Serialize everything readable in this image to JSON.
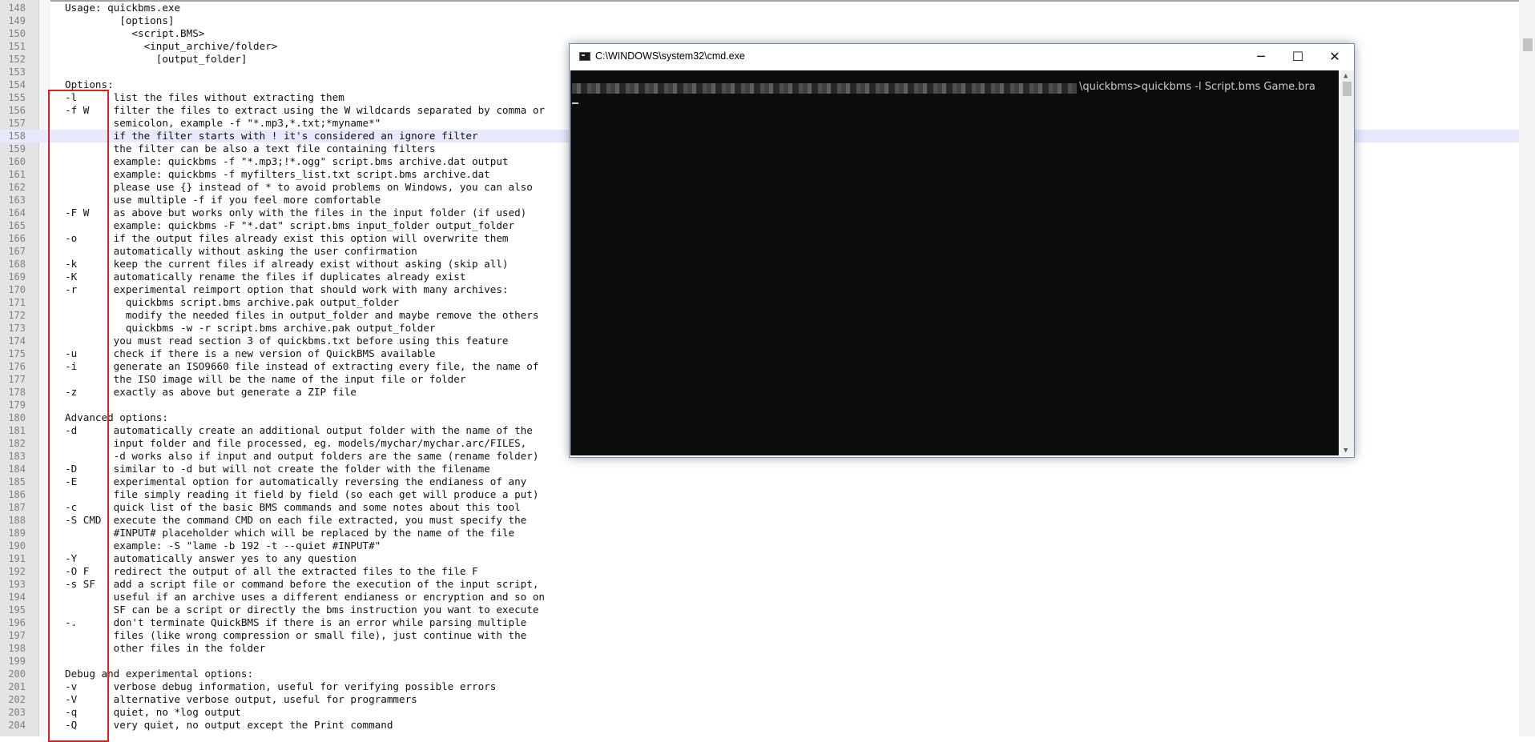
{
  "editor": {
    "current_line": 158,
    "lines": [
      {
        "num": "148",
        "text": "Usage: quickbms.exe"
      },
      {
        "num": "149",
        "text": "         [options]"
      },
      {
        "num": "150",
        "text": "           <script.BMS>"
      },
      {
        "num": "151",
        "text": "             <input_archive/folder>"
      },
      {
        "num": "152",
        "text": "               [output_folder]"
      },
      {
        "num": "153",
        "text": ""
      },
      {
        "num": "154",
        "text": "Options:"
      },
      {
        "num": "155",
        "text": "-l      list the files without extracting them"
      },
      {
        "num": "156",
        "text": "-f W    filter the files to extract using the W wildcards separated by comma or"
      },
      {
        "num": "157",
        "text": "        semicolon, example -f \"*.mp3,*.txt;*myname*\""
      },
      {
        "num": "158",
        "text": "        if the filter starts with ! it's considered an ignore filter"
      },
      {
        "num": "159",
        "text": "        the filter can be also a text file containing filters"
      },
      {
        "num": "160",
        "text": "        example: quickbms -f \"*.mp3;!*.ogg\" script.bms archive.dat output"
      },
      {
        "num": "161",
        "text": "        example: quickbms -f myfilters_list.txt script.bms archive.dat"
      },
      {
        "num": "162",
        "text": "        please use {} instead of * to avoid problems on Windows, you can also"
      },
      {
        "num": "163",
        "text": "        use multiple -f if you feel more comfortable"
      },
      {
        "num": "164",
        "text": "-F W    as above but works only with the files in the input folder (if used)"
      },
      {
        "num": "165",
        "text": "        example: quickbms -F \"*.dat\" script.bms input_folder output_folder"
      },
      {
        "num": "166",
        "text": "-o      if the output files already exist this option will overwrite them"
      },
      {
        "num": "167",
        "text": "        automatically without asking the user confirmation"
      },
      {
        "num": "168",
        "text": "-k      keep the current files if already exist without asking (skip all)"
      },
      {
        "num": "169",
        "text": "-K      automatically rename the files if duplicates already exist"
      },
      {
        "num": "170",
        "text": "-r      experimental reimport option that should work with many archives:"
      },
      {
        "num": "171",
        "text": "          quickbms script.bms archive.pak output_folder"
      },
      {
        "num": "172",
        "text": "          modify the needed files in output_folder and maybe remove the others"
      },
      {
        "num": "173",
        "text": "          quickbms -w -r script.bms archive.pak output_folder"
      },
      {
        "num": "174",
        "text": "        you must read section 3 of quickbms.txt before using this feature"
      },
      {
        "num": "175",
        "text": "-u      check if there is a new version of QuickBMS available"
      },
      {
        "num": "176",
        "text": "-i      generate an ISO9660 file instead of extracting every file, the name of"
      },
      {
        "num": "177",
        "text": "        the ISO image will be the name of the input file or folder"
      },
      {
        "num": "178",
        "text": "-z      exactly as above but generate a ZIP file"
      },
      {
        "num": "179",
        "text": ""
      },
      {
        "num": "180",
        "text": "Advanced options:"
      },
      {
        "num": "181",
        "text": "-d      automatically create an additional output folder with the name of the"
      },
      {
        "num": "182",
        "text": "        input folder and file processed, eg. models/mychar/mychar.arc/FILES,"
      },
      {
        "num": "183",
        "text": "        -d works also if input and output folders are the same (rename folder)"
      },
      {
        "num": "184",
        "text": "-D      similar to -d but will not create the folder with the filename"
      },
      {
        "num": "185",
        "text": "-E      experimental option for automatically reversing the endianess of any"
      },
      {
        "num": "186",
        "text": "        file simply reading it field by field (so each get will produce a put)"
      },
      {
        "num": "187",
        "text": "-c      quick list of the basic BMS commands and some notes about this tool"
      },
      {
        "num": "188",
        "text": "-S CMD  execute the command CMD on each file extracted, you must specify the"
      },
      {
        "num": "189",
        "text": "        #INPUT# placeholder which will be replaced by the name of the file"
      },
      {
        "num": "190",
        "text": "        example: -S \"lame -b 192 -t --quiet #INPUT#\""
      },
      {
        "num": "191",
        "text": "-Y      automatically answer yes to any question"
      },
      {
        "num": "192",
        "text": "-O F    redirect the output of all the extracted files to the file F"
      },
      {
        "num": "193",
        "text": "-s SF   add a script file or command before the execution of the input script,"
      },
      {
        "num": "194",
        "text": "        useful if an archive uses a different endianess or encryption and so on"
      },
      {
        "num": "195",
        "text": "        SF can be a script or directly the bms instruction you want to execute"
      },
      {
        "num": "196",
        "text": "-.      don't terminate QuickBMS if there is an error while parsing multiple"
      },
      {
        "num": "197",
        "text": "        files (like wrong compression or small file), just continue with the"
      },
      {
        "num": "198",
        "text": "        other files in the folder"
      },
      {
        "num": "199",
        "text": ""
      },
      {
        "num": "200",
        "text": "Debug and experimental options:"
      },
      {
        "num": "201",
        "text": "-v      verbose debug information, useful for verifying possible errors"
      },
      {
        "num": "202",
        "text": "-V      alternative verbose output, useful for programmers"
      },
      {
        "num": "203",
        "text": "-q      quiet, no *log output"
      },
      {
        "num": "204",
        "text": "-Q      very quiet, no output except the Print command"
      }
    ]
  },
  "cmd": {
    "title": "C:\\WINDOWS\\system32\\cmd.exe",
    "minimize_glyph": "─",
    "maximize_glyph": "☐",
    "close_glyph": "✕",
    "command_line": "\\quickbms>quickbms -l Script.bms Game.bra",
    "icon": "console-icon"
  }
}
